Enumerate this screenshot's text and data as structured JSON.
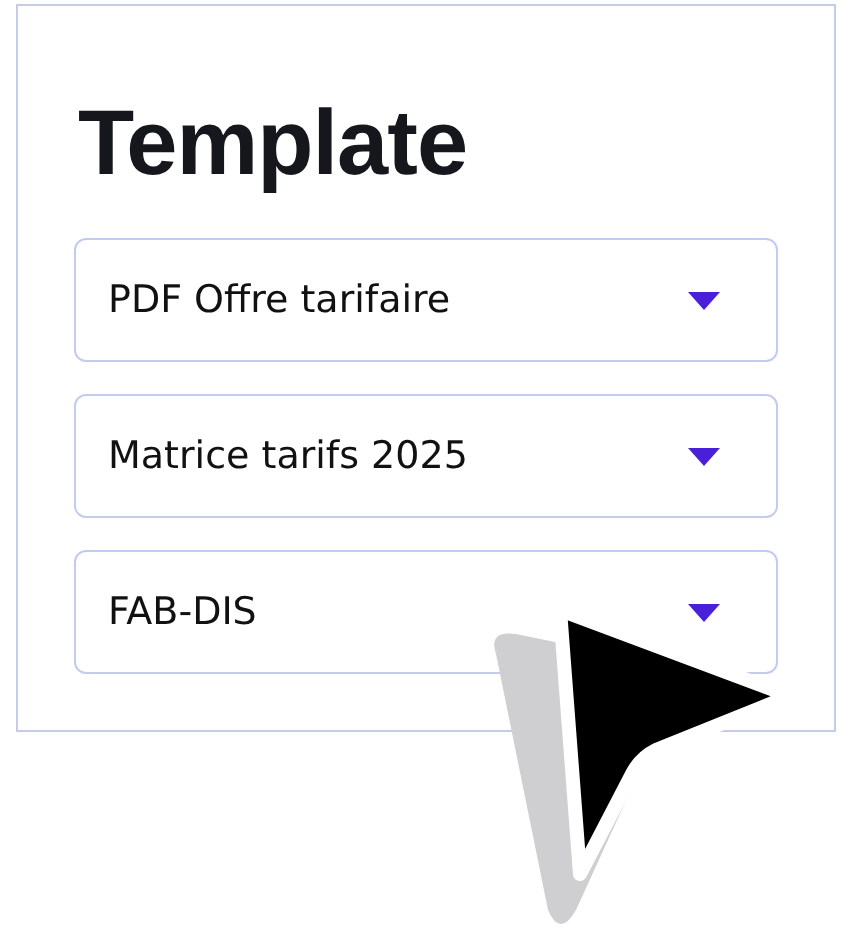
{
  "panel": {
    "title": "Template",
    "dropdowns": [
      {
        "value": "PDF Offre tarifaire"
      },
      {
        "value": "Matrice tarifs 2025"
      },
      {
        "value": "FAB-DIS"
      }
    ]
  }
}
